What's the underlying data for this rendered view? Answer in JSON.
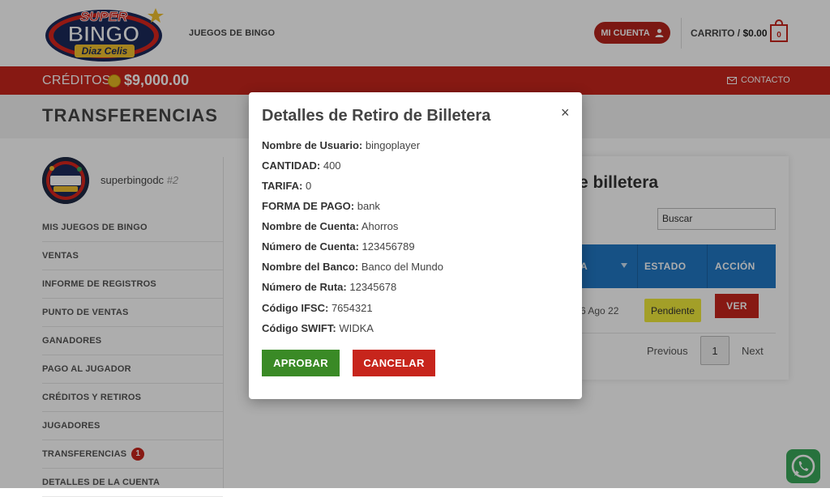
{
  "header": {
    "logo_text_1": "SUPER",
    "logo_text_2": "BINGO",
    "logo_text_3": "Diaz Celis",
    "nav_games": "JUEGOS DE BINGO",
    "account_label": "MI CUENTA",
    "cart_label": "CARRITO /",
    "cart_amount": "$0.00",
    "cart_count": "0"
  },
  "credits_bar": {
    "label": "CRÉDITOS",
    "amount": "$9,000.00",
    "contact_label": "CONTACTO"
  },
  "page": {
    "title": "TRANSFERENCIAS"
  },
  "profile": {
    "username": "superbingodc",
    "user_id": "#2"
  },
  "sidebar": {
    "items": [
      {
        "label": "MIS JUEGOS DE BINGO"
      },
      {
        "label": "VENTAS"
      },
      {
        "label": "INFORME DE REGISTROS"
      },
      {
        "label": "PUNTO DE VENTAS"
      },
      {
        "label": "GANADORES"
      },
      {
        "label": "PAGO AL JUGADOR"
      },
      {
        "label": "CRÉDITOS Y RETIROS"
      },
      {
        "label": "JUGADORES"
      },
      {
        "label": "TRANSFERENCIAS",
        "badge": "1"
      },
      {
        "label": "DETALLES DE LA CUENTA"
      }
    ]
  },
  "main": {
    "card_title_fragment": "e billetera",
    "search_placeholder": "Buscar",
    "columns": [
      "A",
      "ESTADO",
      "ACCIÓN"
    ],
    "row": {
      "date": "6 Ago 22",
      "status": "Pendiente",
      "action": "VER"
    },
    "pager": {
      "previous": "Previous",
      "current": "1",
      "next": "Next"
    }
  },
  "modal": {
    "title": "Detalles de Retiro de Billetera",
    "close": "×",
    "fields": [
      {
        "label": "Nombre de Usuario:",
        "value": "bingoplayer"
      },
      {
        "label": "CANTIDAD:",
        "value": "400"
      },
      {
        "label": "TARIFA:",
        "value": "0"
      },
      {
        "label": "FORMA DE PAGO:",
        "value": "bank"
      },
      {
        "label": "Nombre de Cuenta:",
        "value": "Ahorros"
      },
      {
        "label": "Número de Cuenta:",
        "value": "123456789"
      },
      {
        "label": "Nombre del Banco:",
        "value": "Banco del Mundo"
      },
      {
        "label": "Número de Ruta:",
        "value": "12345678"
      },
      {
        "label": "Código IFSC:",
        "value": "7654321"
      },
      {
        "label": "Código SWIFT:",
        "value": "WIDKA"
      }
    ],
    "approve_label": "APROBAR",
    "cancel_label": "CANCELAR"
  },
  "colors": {
    "brand_red": "#c7251c",
    "table_header_blue": "#2178c5",
    "approve_green": "#3a8a26",
    "pending_yellow": "#f0ea3b",
    "whatsapp_green": "#3aa85a"
  },
  "icons": {
    "account": "user-icon",
    "cart": "shopping-bag-icon",
    "coin": "coin-icon",
    "contact": "envelope-icon",
    "sort": "sort-arrow-icon",
    "whatsapp": "whatsapp-icon"
  }
}
